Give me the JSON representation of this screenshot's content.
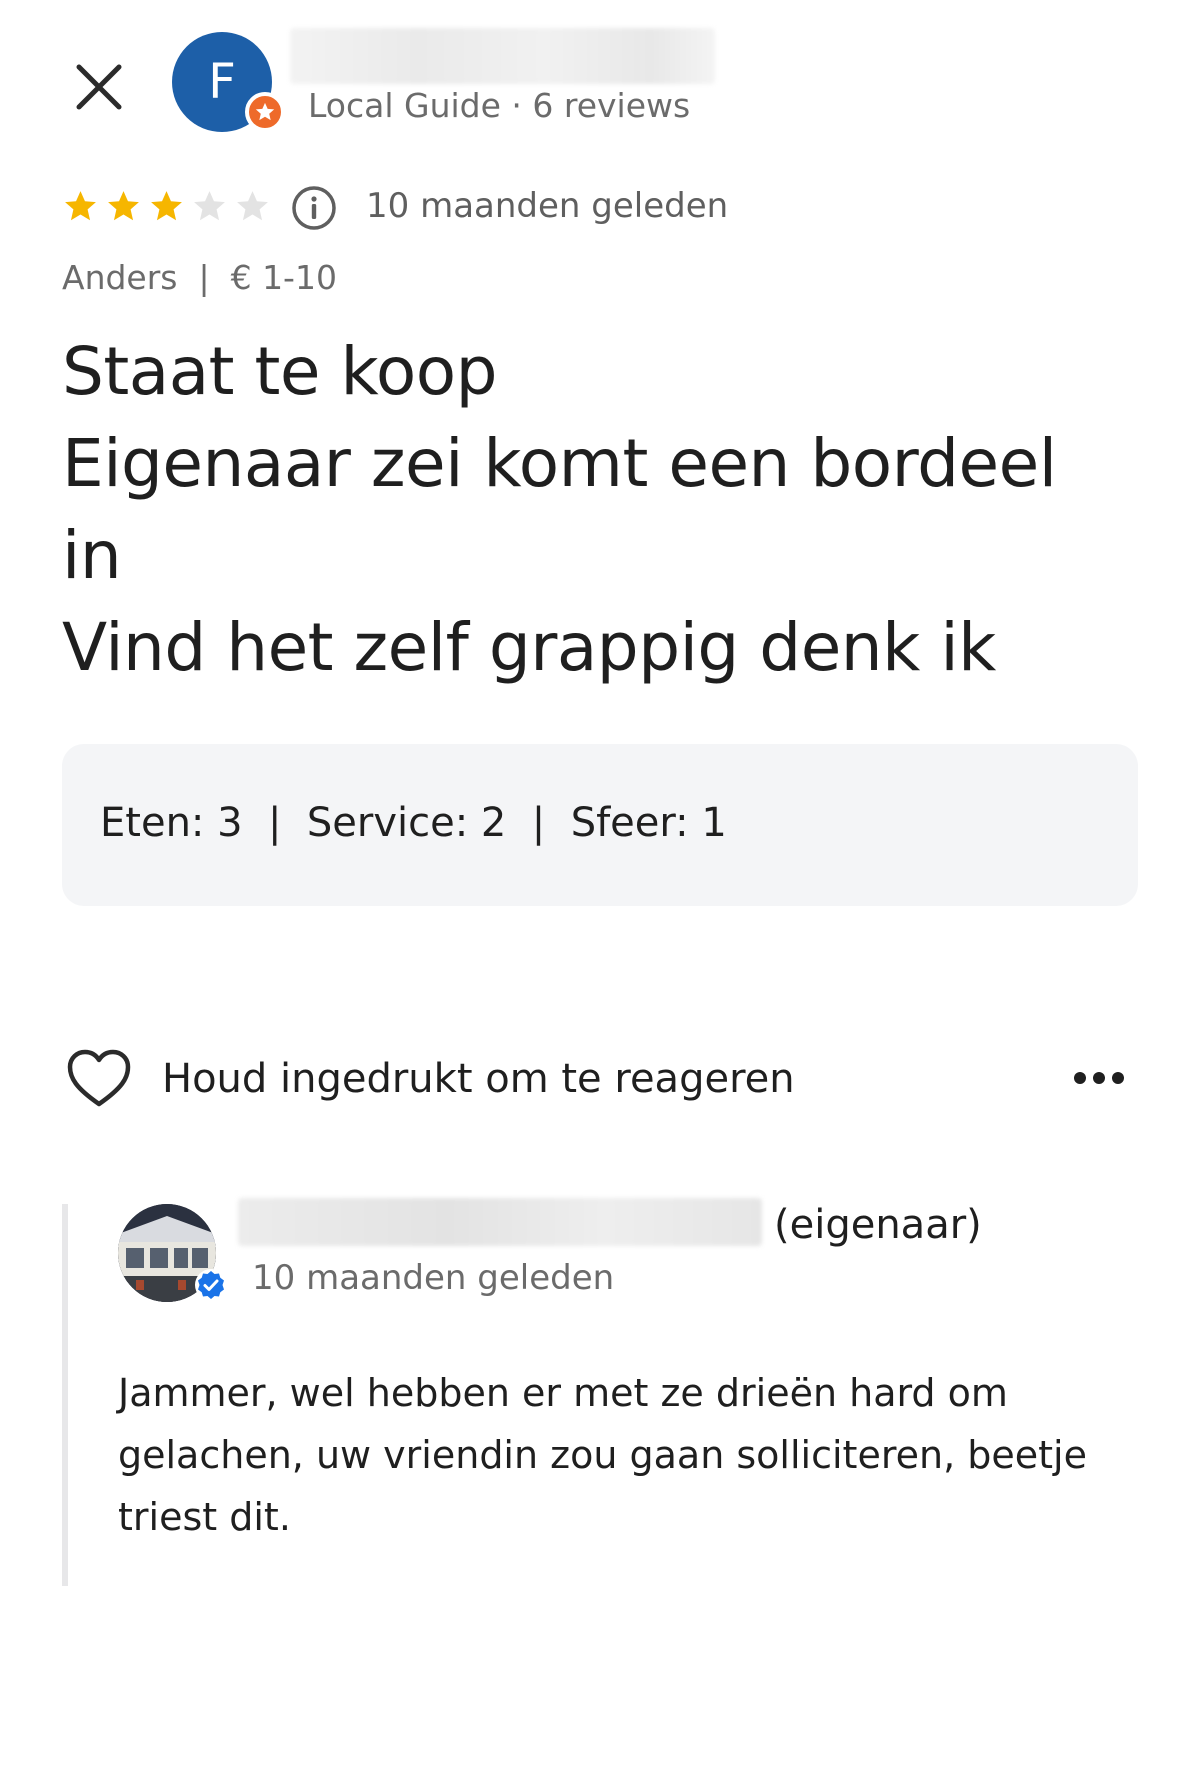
{
  "header": {
    "close_icon": "close-icon",
    "avatar_initial": "F",
    "reviewer_meta": "Local Guide · 6 reviews",
    "badge_color": "#ee6a2a",
    "avatar_color": "#1d5fa8"
  },
  "review": {
    "stars_filled": 3,
    "stars_total": 5,
    "star_color": "#f6b600",
    "time_ago": "10 maanden geleden",
    "meta": "Anders  |  € 1-10",
    "text_lines": [
      "Staat te koop",
      "Eigenaar zei komt een bordeel",
      "in",
      "Vind het zelf grappig denk ik"
    ],
    "ratings": "Eten: 3  |  Service: 2  |  Sfeer: 1"
  },
  "actions": {
    "react_label": "Houd ingedrukt om te reageren",
    "heart_icon": "heart-outline-icon",
    "more_icon": "more-horizontal-icon"
  },
  "owner_reply": {
    "tag": "(eigenaar)",
    "time_ago": "10 maanden geleden",
    "text": "Jammer, wel hebben er met ze drieën hard om gelachen, uw vriendin zou gaan solliciteren, beetje triest dit.",
    "verified_color": "#1a73e8"
  }
}
